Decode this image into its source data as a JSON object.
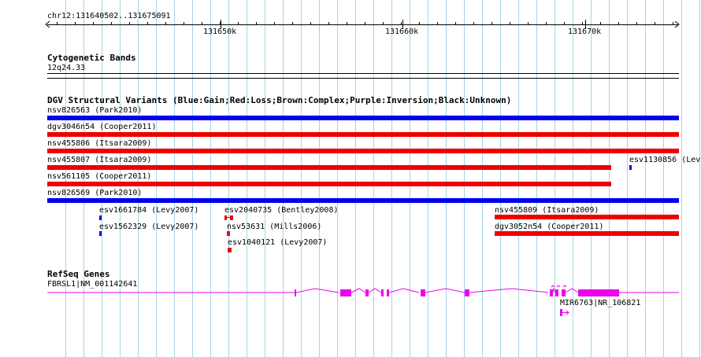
{
  "ruler": {
    "region": "chr12:131640502..131675091",
    "ticks": [
      "131650k",
      "131660k",
      "131670k"
    ]
  },
  "tracks": {
    "cytoband": {
      "title": "Cytogenetic Bands",
      "band": "12q24.33"
    },
    "dgv": {
      "title": "DGV Structural Variants (Blue:Gain;Red:Loss;Brown:Complex;Purple:Inversion;Black:Unknown)",
      "colors": {
        "gain": "#0000ee",
        "loss": "#ee0000"
      },
      "variants": [
        {
          "label": "nsv826563 (Park2010)",
          "type": "gain"
        },
        {
          "label": "dgv3046n54 (Cooper2011)",
          "type": "loss"
        },
        {
          "label": "nsv455806 (Itsara2009)",
          "type": "loss"
        },
        {
          "label": "nsv455807 (Itsara2009)",
          "type": "loss"
        },
        {
          "label": "esv1130856 (Lev",
          "type": "gain"
        },
        {
          "label": "nsv561105 (Cooper2011)",
          "type": "loss"
        },
        {
          "label": "nsv826569 (Park2010)",
          "type": "gain"
        },
        {
          "label": "esv1661784 (Levy2007)",
          "type": "gain"
        },
        {
          "label": "esv2040735 (Bentley2008)",
          "type": "loss"
        },
        {
          "label": "nsv455809 (Itsara2009)",
          "type": "loss"
        },
        {
          "label": "esv1562329 (Levy2007)",
          "type": "gain"
        },
        {
          "label": "nsv53631 (Mills2006)",
          "type": "loss"
        },
        {
          "label": "dgv3052n54 (Cooper2011)",
          "type": "loss"
        },
        {
          "label": "esv1040121 (Levy2007)",
          "type": "loss"
        }
      ]
    },
    "refseq": {
      "title": "RefSeq Genes",
      "color": "#ee00ee",
      "genes": [
        {
          "label": "FBRSL1|NM_001142641"
        },
        {
          "label": "MIR6763|NR_106821"
        }
      ]
    }
  }
}
